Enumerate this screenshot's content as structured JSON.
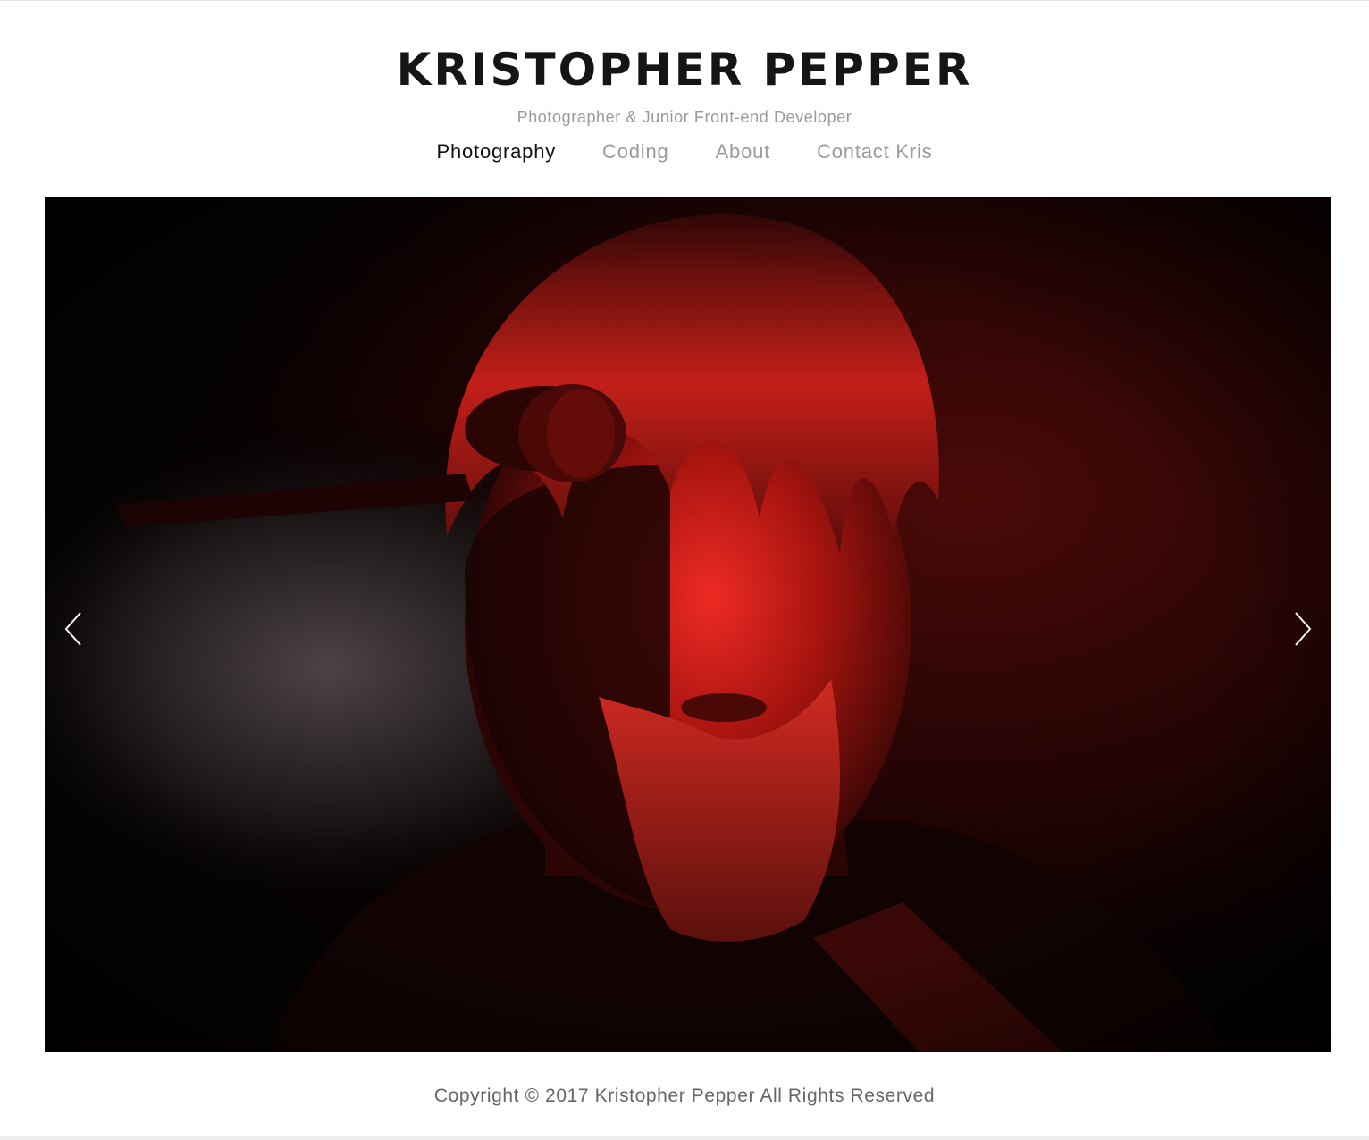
{
  "header": {
    "title": "KRISTOPHER PEPPER",
    "tagline": "Photographer & Junior Front-end Developer"
  },
  "nav": {
    "items": [
      {
        "label": "Photography",
        "active": true
      },
      {
        "label": "Coding",
        "active": false
      },
      {
        "label": "About",
        "active": false
      },
      {
        "label": "Contact Kris",
        "active": false
      }
    ]
  },
  "slideshow": {
    "prev_icon": "chevron-left-icon",
    "next_icon": "chevron-right-icon"
  },
  "footer": {
    "copyright": "Copyright © 2017 Kristopher Pepper All Rights Reserved"
  },
  "colors": {
    "title": "#151515",
    "nav_active": "#111111",
    "nav_inactive": "#9a9a9a",
    "photo_accent": "#c0211e"
  }
}
